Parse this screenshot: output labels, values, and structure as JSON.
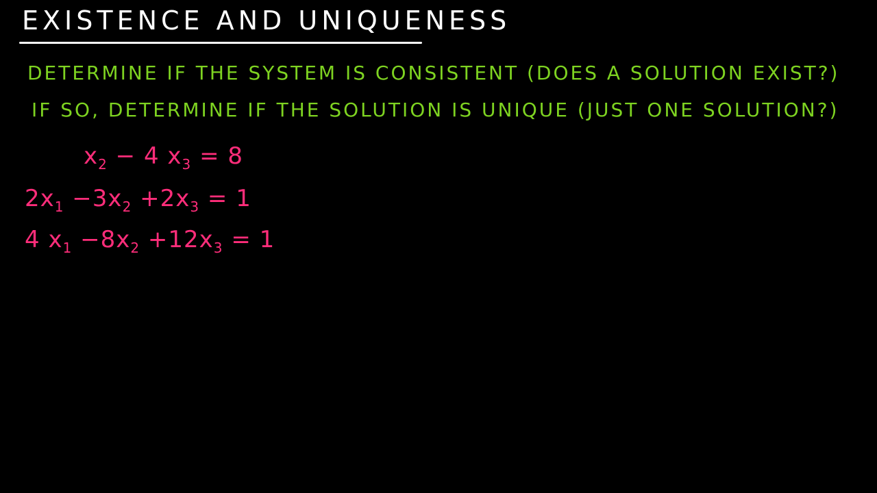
{
  "title": "EXISTENCE AND UNIQUENESS",
  "instructions": {
    "line1": "DETERMINE IF THE SYSTEM IS CONSISTENT (DOES A SOLUTION EXIST?)",
    "line2": "IF SO, DETERMINE IF THE SOLUTION IS UNIQUE (JUST ONE SOLUTION?)"
  },
  "equations": [
    {
      "terms": [
        {
          "text": "x",
          "sub": "2"
        },
        {
          "text": " − 4 x",
          "sub": "3"
        },
        {
          "text": " = 8",
          "sub": ""
        }
      ]
    },
    {
      "terms": [
        {
          "text": "2x",
          "sub": "1"
        },
        {
          "text": " −3x",
          "sub": "2"
        },
        {
          "text": " +2x",
          "sub": "3"
        },
        {
          "text": "  =  1",
          "sub": ""
        }
      ]
    },
    {
      "terms": [
        {
          "text": "4 x",
          "sub": "1"
        },
        {
          "text": " −8x",
          "sub": "2"
        },
        {
          "text": " +12x",
          "sub": "3"
        },
        {
          "text": "  =  1",
          "sub": ""
        }
      ]
    }
  ],
  "colors": {
    "background": "#000000",
    "title": "#ffffff",
    "instructions": "#7ed321",
    "equations": "#ff2d7a"
  }
}
